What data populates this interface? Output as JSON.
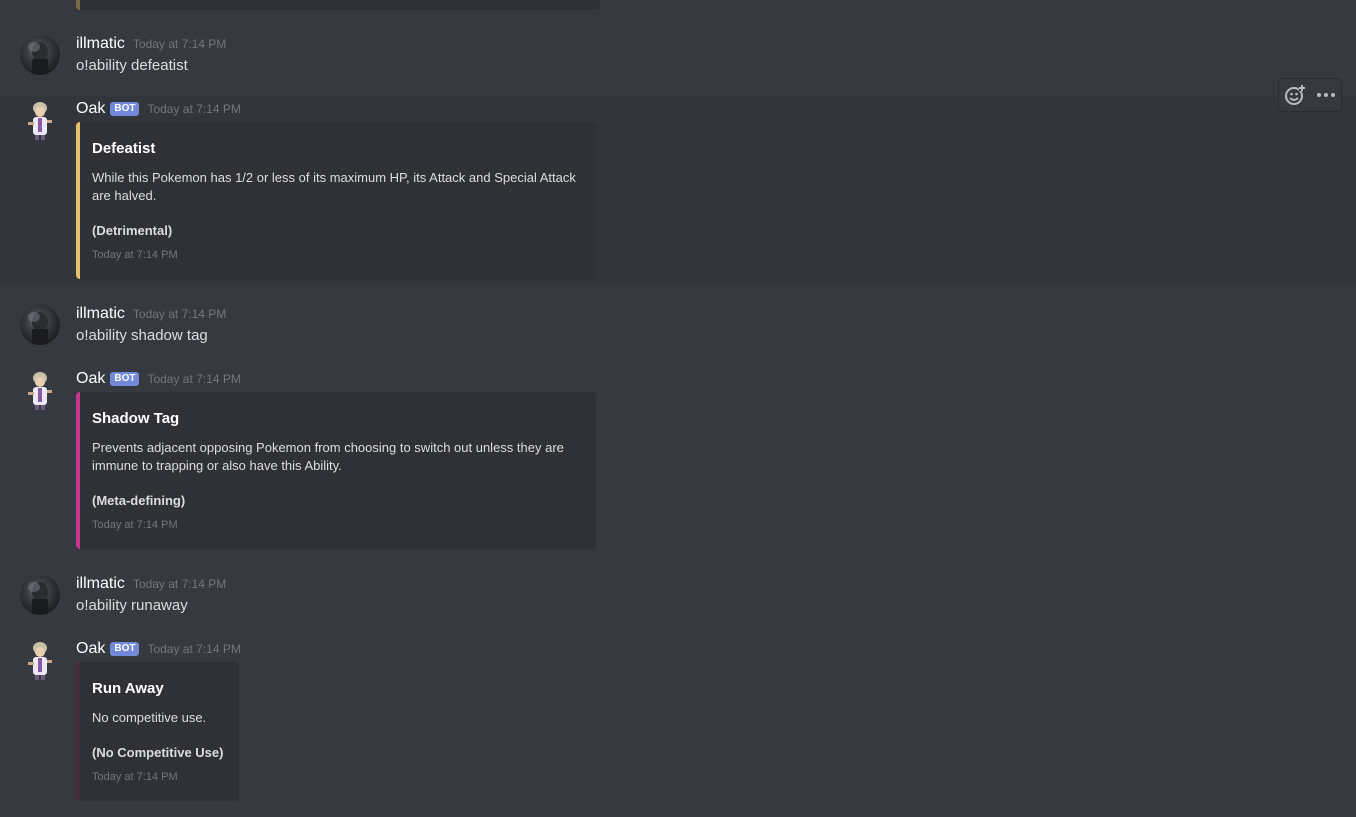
{
  "colors": {
    "background": "#36393f",
    "embed_background": "#2f3136",
    "bot_tag": "#7289da",
    "defeatist_bar": "#e6c06b",
    "shadow_tag_bar": "#c5388f",
    "run_away_bar": "#4a2a3f"
  },
  "hover_actions": {
    "icons": [
      "add-reaction-icon",
      "more-options-icon"
    ]
  },
  "messages": [
    {
      "author": "illmatic",
      "timestamp": "Today at 7:14 PM",
      "content": "o!ability defeatist"
    },
    {
      "author": "Oak",
      "bot_tag": "BOT",
      "timestamp": "Today at 7:14 PM",
      "embed": {
        "title": "Defeatist",
        "description": "While this Pokemon has 1/2 or less of its maximum HP, its Attack and Special Attack are halved.",
        "rating": "(Detrimental)",
        "footer": "Today at 7:14 PM"
      }
    },
    {
      "author": "illmatic",
      "timestamp": "Today at 7:14 PM",
      "content": "o!ability shadow tag"
    },
    {
      "author": "Oak",
      "bot_tag": "BOT",
      "timestamp": "Today at 7:14 PM",
      "embed": {
        "title": "Shadow Tag",
        "description": "Prevents adjacent opposing Pokemon from choosing to switch out unless they are immune to trapping or also have this Ability.",
        "rating": "(Meta-defining)",
        "footer": "Today at 7:14 PM"
      }
    },
    {
      "author": "illmatic",
      "timestamp": "Today at 7:14 PM",
      "content": "o!ability runaway"
    },
    {
      "author": "Oak",
      "bot_tag": "BOT",
      "timestamp": "Today at 7:14 PM",
      "embed": {
        "title": "Run Away",
        "description": "No competitive use.",
        "rating": "(No Competitive Use)",
        "footer": "Today at 7:14 PM"
      }
    }
  ]
}
